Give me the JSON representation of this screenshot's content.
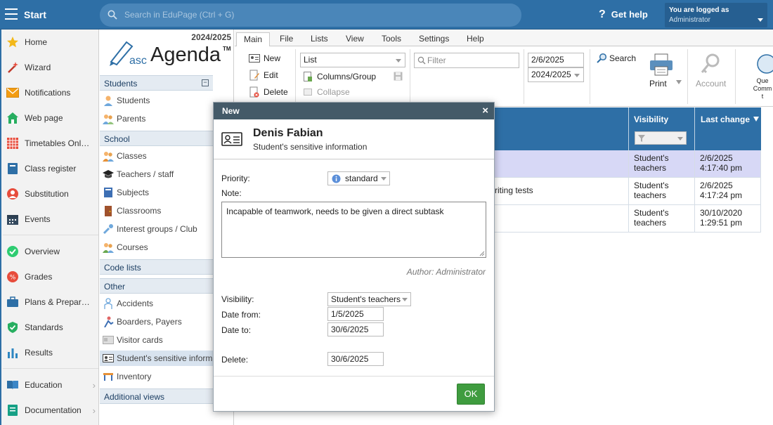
{
  "topbar": {
    "start_label": "Start",
    "search_placeholder": "Search in EduPage (Ctrl + G)",
    "get_help": "Get help",
    "logged_as_label": "You are logged as",
    "logged_as_user": "Administrator"
  },
  "leftnav": {
    "items": [
      {
        "label": "Home",
        "icon": "star-icon"
      },
      {
        "label": "Wizard",
        "icon": "magic-wand-icon"
      },
      {
        "label": "Notifications",
        "icon": "envelope-icon"
      },
      {
        "label": "Web page",
        "icon": "house-icon"
      },
      {
        "label": "Timetables Onl…",
        "icon": "timetable-grid-icon"
      },
      {
        "label": "Class register",
        "icon": "book-icon"
      },
      {
        "label": "Substitution",
        "icon": "substitute-person-icon"
      },
      {
        "label": "Events",
        "icon": "calendar-icon"
      },
      {
        "label": "Overview",
        "icon": "check-circle-icon"
      },
      {
        "label": "Grades",
        "icon": "grades-icon"
      },
      {
        "label": "Plans & Prepar…",
        "icon": "briefcase-icon"
      },
      {
        "label": "Standards",
        "icon": "shield-check-icon"
      },
      {
        "label": "Results",
        "icon": "bar-chart-icon"
      },
      {
        "label": "Education",
        "icon": "open-book-icon"
      },
      {
        "label": "Documentation",
        "icon": "document-icon"
      }
    ]
  },
  "tree": {
    "year": "2024/2025",
    "logo_asc": "asc",
    "logo_agenda": "Agenda",
    "logo_tm": "TM",
    "sections": {
      "students": "Students",
      "school": "School",
      "code_lists": "Code lists",
      "other": "Other",
      "additional": "Additional views"
    },
    "items": {
      "students": "Students",
      "parents": "Parents",
      "classes": "Classes",
      "teachers": "Teachers / staff",
      "subjects": "Subjects",
      "classrooms": "Classrooms",
      "interest_groups": "Interest groups / Club",
      "courses": "Courses",
      "accidents": "Accidents",
      "boarders": "Boarders, Payers",
      "visitor_cards": "Visitor cards",
      "sensitive": "Student's sensitive informa",
      "inventory": "Inventory"
    }
  },
  "ribbon": {
    "tabs": [
      "Main",
      "File",
      "Lists",
      "View",
      "Tools",
      "Settings",
      "Help"
    ],
    "new_label": "New",
    "edit_label": "Edit",
    "delete_label": "Delete",
    "list_select": "List",
    "columns_group": "Columns/Group",
    "collapse": "Collapse",
    "filter_placeholder": "Filter",
    "date_value": "2/6/2025",
    "year_select": "2024/2025",
    "search_label": "Search",
    "print_label": "Print",
    "account_label": "Account",
    "questions_label": "Que\nComm\nt"
  },
  "table": {
    "headers": {
      "visibility": "Visibility",
      "last_change": "Last change"
    },
    "rows": [
      {
        "text": "",
        "visibility": "Student's teachers",
        "last_change": "2/6/2025 4:17:40 pm",
        "selected": true
      },
      {
        "text": "riting tests",
        "visibility": "Student's teachers",
        "last_change": "2/6/2025 4:17:24 pm",
        "selected": false
      },
      {
        "text": "",
        "visibility": "Student's teachers",
        "last_change": "30/10/2020 1:29:51 pm",
        "selected": false
      }
    ]
  },
  "dialog": {
    "title": "New",
    "close": "×",
    "person_name": "Denis Fabian",
    "subtitle": "Student's sensitive information",
    "priority_label": "Priority:",
    "priority_value": "standard",
    "note_label": "Note:",
    "note_value": "Incapable of teamwork, needs to be given a direct subtask",
    "author": "Author: Administrator",
    "visibility_label": "Visibility:",
    "visibility_value": "Student's teachers",
    "date_from_label": "Date from:",
    "date_from_value": "1/5/2025",
    "date_to_label": "Date to:",
    "date_to_value": "30/6/2025",
    "delete_label": "Delete:",
    "delete_value": "30/6/2025",
    "ok_label": "OK"
  },
  "colors": {
    "topbar": "#2e6fa6",
    "dialog_title": "#445a68",
    "ok_button": "#3f9c3f",
    "selected_row": "#d7d8f6"
  }
}
